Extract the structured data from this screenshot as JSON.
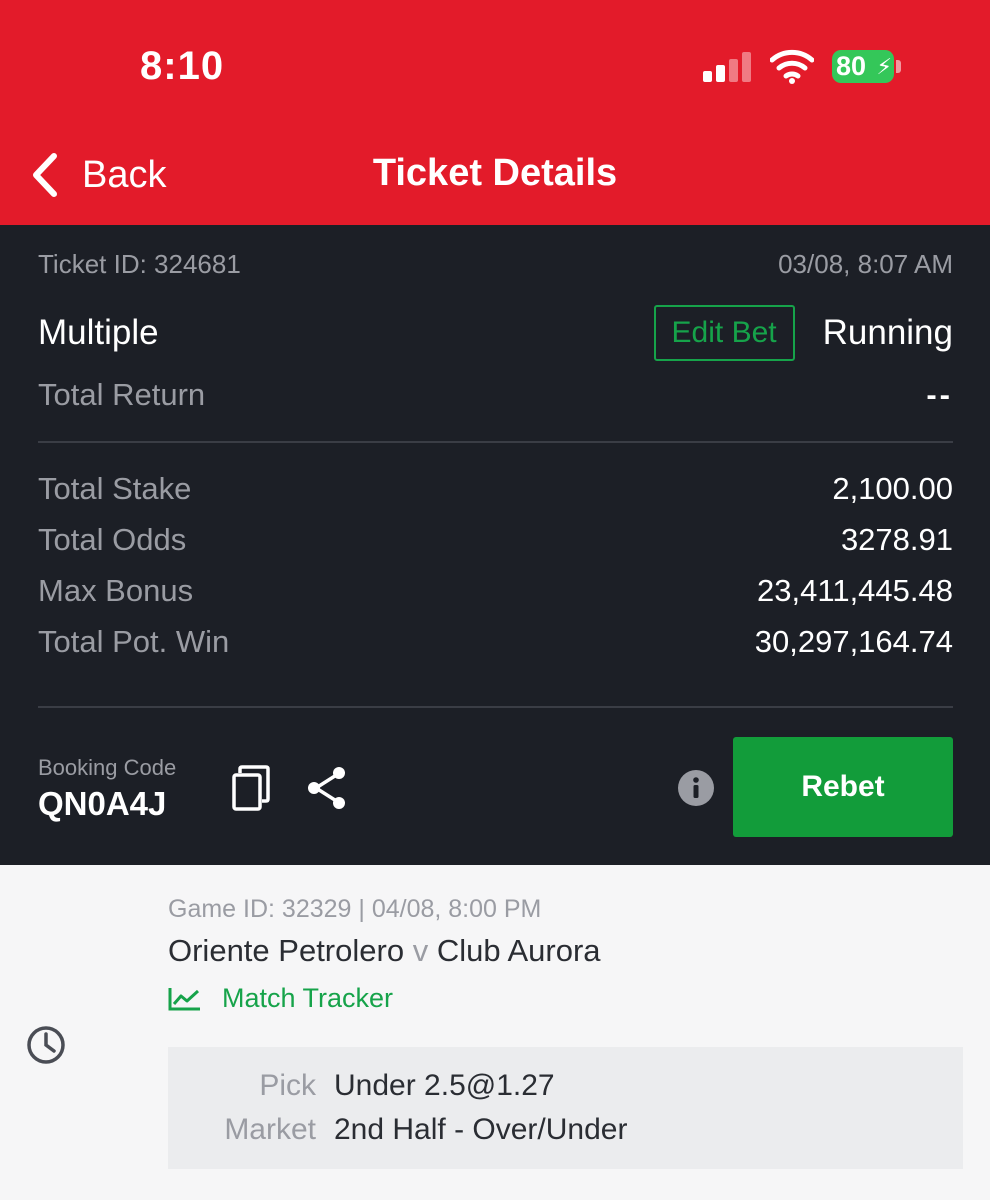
{
  "status_bar": {
    "time": "8:10",
    "battery": "80"
  },
  "nav": {
    "back_label": "Back",
    "title": "Ticket Details"
  },
  "ticket": {
    "id_text": "Ticket ID: 324681",
    "date": "03/08, 8:07 AM",
    "bet_type": "Multiple",
    "edit_label": "Edit Bet",
    "status": "Running",
    "total_return_label": "Total Return",
    "total_return_value": "--",
    "summary": [
      {
        "label": "Total Stake",
        "value": "2,100.00"
      },
      {
        "label": "Total Odds",
        "value": "3278.91"
      },
      {
        "label": "Max Bonus",
        "value": "23,411,445.48"
      },
      {
        "label": "Total Pot. Win",
        "value": "30,297,164.74"
      }
    ],
    "booking_label": "Booking Code",
    "booking_code": "QN0A4J",
    "rebet_label": "Rebet"
  },
  "game": {
    "meta": "Game ID: 32329 | 04/08, 8:00 PM",
    "home": "Oriente Petrolero",
    "vs": "v",
    "away": "Club Aurora",
    "tracker_label": "Match Tracker",
    "pick_label": "Pick",
    "pick_value": "Under 2.5@1.27",
    "market_label": "Market",
    "market_value": "2nd Half - Over/Under"
  },
  "colors": {
    "brand_red": "#e31b2a",
    "panel": "#1c1f26",
    "accent_green": "#129c3a"
  },
  "icons": [
    "chevron-left-icon",
    "signal-icon",
    "wifi-icon",
    "battery-icon",
    "copy-icon",
    "share-icon",
    "info-icon",
    "trend-chart-icon",
    "clock-icon"
  ]
}
